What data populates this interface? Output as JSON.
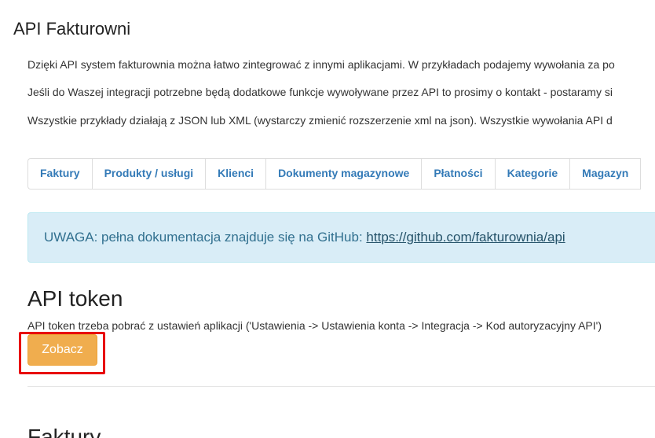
{
  "page": {
    "title": "API Fakturowni"
  },
  "intro": {
    "p1": "Dzięki API system fakturownia można łatwo zintegrować z innymi aplikacjami. W przykładach podajemy wywołania za po",
    "p2": "Jeśli do Waszej integracji potrzebne będą dodatkowe funkcje wywoływane przez API to prosimy o kontakt - postaramy si",
    "p3": "Wszystkie przykłady działają z JSON lub XML (wystarczy zmienić rozszerzenie xml na json). Wszystkie wywołania API d"
  },
  "tabs": [
    {
      "label": "Faktury"
    },
    {
      "label": "Produkty / usługi"
    },
    {
      "label": "Klienci"
    },
    {
      "label": "Dokumenty magazynowe"
    },
    {
      "label": "Płatności"
    },
    {
      "label": "Kategorie"
    },
    {
      "label": "Magazyn"
    }
  ],
  "alert": {
    "text": "UWAGA: pełna dokumentacja znajduje się na GitHub: ",
    "link": "https://github.com/fakturownia/api"
  },
  "api_token": {
    "title": "API token",
    "description": "API token trzeba pobrać z ustawień aplikacji ('Ustawienia -> Ustawienia konta -> Integracja -> Kod autoryzacyjny API')",
    "button_label": "Zobacz"
  },
  "next_section": {
    "title": "Faktury"
  },
  "colors": {
    "accent_link": "#337ab7",
    "alert_bg": "#d9edf7",
    "button_warning": "#f0ad4e",
    "highlight_red": "#e8000b"
  }
}
